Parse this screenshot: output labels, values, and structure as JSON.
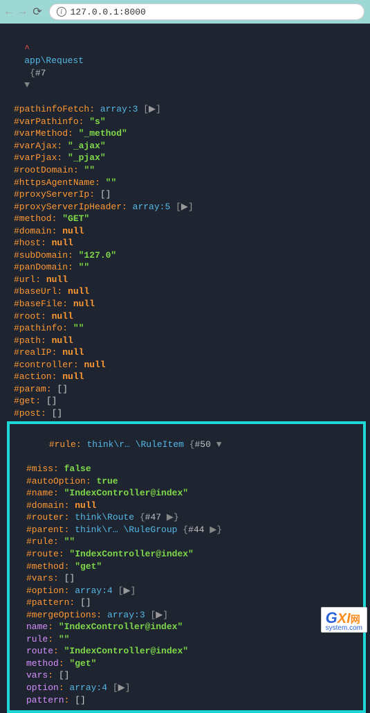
{
  "browser": {
    "url": "127.0.0.1:8000"
  },
  "header": {
    "caret": "^",
    "class_name": "app\\Request",
    "id": "#7",
    "tri": "▼"
  },
  "props": [
    {
      "key": "#pathinfoFetch",
      "type": "array",
      "value": "array:3",
      "expand": true
    },
    {
      "key": "#varPathinfo",
      "type": "string",
      "value": "\"s\""
    },
    {
      "key": "#varMethod",
      "type": "string",
      "value": "\"_method\""
    },
    {
      "key": "#varAjax",
      "type": "string",
      "value": "\"_ajax\""
    },
    {
      "key": "#varPjax",
      "type": "string",
      "value": "\"_pjax\""
    },
    {
      "key": "#rootDomain",
      "type": "string",
      "value": "\"\""
    },
    {
      "key": "#httpsAgentName",
      "type": "string",
      "value": "\"\""
    },
    {
      "key": "#proxyServerIp",
      "type": "arrlit",
      "value": "[]"
    },
    {
      "key": "#proxyServerIpHeader",
      "type": "array",
      "value": "array:5",
      "expand": true
    },
    {
      "key": "#method",
      "type": "string",
      "value": "\"GET\""
    },
    {
      "key": "#domain",
      "type": "null",
      "value": "null"
    },
    {
      "key": "#host",
      "type": "null",
      "value": "null"
    },
    {
      "key": "#subDomain",
      "type": "string",
      "value": "\"127.0\""
    },
    {
      "key": "#panDomain",
      "type": "string",
      "value": "\"\""
    },
    {
      "key": "#url",
      "type": "null",
      "value": "null"
    },
    {
      "key": "#baseUrl",
      "type": "null",
      "value": "null"
    },
    {
      "key": "#baseFile",
      "type": "null",
      "value": "null"
    },
    {
      "key": "#root",
      "type": "null",
      "value": "null"
    },
    {
      "key": "#pathinfo",
      "type": "string",
      "value": "\"\""
    },
    {
      "key": "#path",
      "type": "null",
      "value": "null"
    },
    {
      "key": "#realIP",
      "type": "null",
      "value": "null"
    },
    {
      "key": "#controller",
      "type": "null",
      "value": "null"
    },
    {
      "key": "#action",
      "type": "null",
      "value": "null"
    },
    {
      "key": "#param",
      "type": "arrlit",
      "value": "[]"
    },
    {
      "key": "#get",
      "type": "arrlit",
      "value": "[]"
    },
    {
      "key": "#post",
      "type": "arrlit",
      "value": "[]"
    }
  ],
  "rule": {
    "label": "#rule",
    "class": "think\\r… \\RuleItem",
    "id": "#50",
    "tri": "▼",
    "children": [
      {
        "key": "#miss",
        "type": "bool",
        "value": "false"
      },
      {
        "key": "#autoOption",
        "type": "bool",
        "value": "true"
      },
      {
        "key": "#name",
        "type": "string",
        "value": "\"IndexController@index\""
      },
      {
        "key": "#domain",
        "type": "null",
        "value": "null"
      },
      {
        "key": "#router",
        "type": "obj",
        "value": "think\\Route",
        "id": "#47",
        "expand": true
      },
      {
        "key": "#parent",
        "type": "obj",
        "value": "think\\r… \\RuleGroup",
        "id": "#44",
        "expand": true
      },
      {
        "key": "#rule",
        "type": "string",
        "value": "\"\""
      },
      {
        "key": "#route",
        "type": "string",
        "value": "\"IndexController@index\""
      },
      {
        "key": "#method",
        "type": "string",
        "value": "\"get\""
      },
      {
        "key": "#vars",
        "type": "arrlit",
        "value": "[]"
      },
      {
        "key": "#option",
        "type": "array",
        "value": "array:4",
        "expand": true
      },
      {
        "key": "#pattern",
        "type": "arrlit",
        "value": "[]"
      },
      {
        "key": "#mergeOptions",
        "type": "array",
        "value": "array:3",
        "expand": true
      },
      {
        "key": "name",
        "type": "string",
        "value": "\"IndexController@index\"",
        "pub": true
      },
      {
        "key": "rule",
        "type": "string",
        "value": "\"\"",
        "pub": true
      },
      {
        "key": "route",
        "type": "string",
        "value": "\"IndexController@index\"",
        "pub": true
      },
      {
        "key": "method",
        "type": "string",
        "value": "\"get\"",
        "pub": true
      },
      {
        "key": "vars",
        "type": "arrlit",
        "value": "[]",
        "pub": true
      },
      {
        "key": "option",
        "type": "array",
        "value": "array:4",
        "expand": true,
        "pub": true
      },
      {
        "key": "pattern",
        "type": "arrlit",
        "value": "[]",
        "pub": true
      }
    ]
  },
  "logo": {
    "g": "G",
    "xi": "XI",
    "cn": "网",
    "sub": "system.com"
  }
}
